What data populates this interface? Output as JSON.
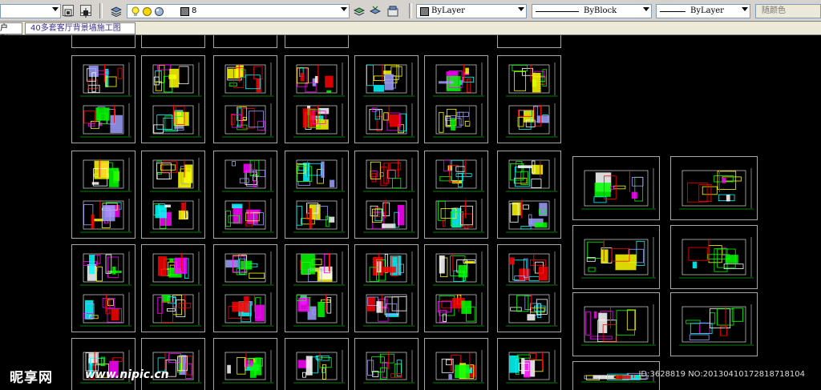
{
  "toolbar": {
    "layer_value": "8",
    "color_control": "ByLayer",
    "linetype_control": "ByBlock",
    "lineweight_control": "ByLayer",
    "plotstyle_control": "随颜色"
  },
  "tabs": {
    "partial_tab": "户型",
    "active_tab": "40多套客厅背景墙施工图"
  },
  "watermark": {
    "logo": "昵享网",
    "url": "www.nipic.cn",
    "id_text": "ID:3628819 NO:20130410172818718104"
  },
  "colors": {
    "canvas": "#000000",
    "frame_border": "#a8a8a8",
    "toolbar_bg": "#d6d3ce",
    "tab_bg": "#ece9d8",
    "drawing_palette": [
      "#ffff00",
      "#00ffff",
      "#ff0000",
      "#ffffff",
      "#ff00ff",
      "#00ff00",
      "#a0a0ff"
    ]
  },
  "icons": [
    "layer-manager-icon",
    "layer-on-icon",
    "layer-freeze-icon",
    "layer-color-icon",
    "make-current-icon",
    "layer-previous-icon",
    "layer-states-icon",
    "named-views-icon",
    "properties-icon"
  ]
}
